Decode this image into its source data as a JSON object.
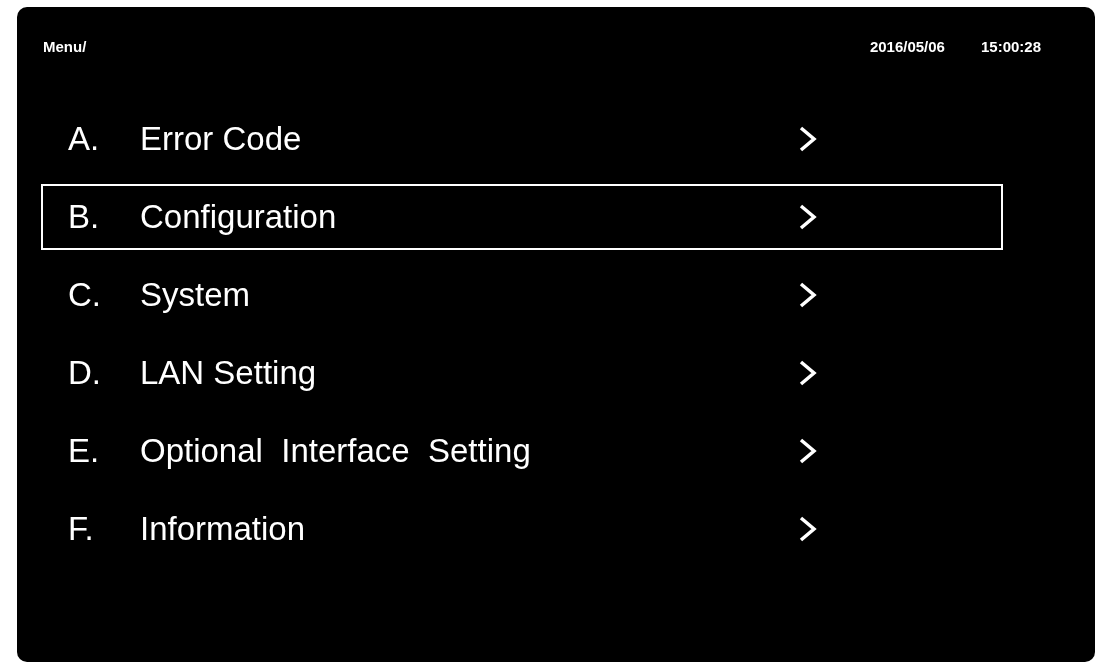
{
  "header": {
    "title": "Menu/",
    "date": "2016/05/06",
    "time": "15:00:28"
  },
  "menu": [
    {
      "letter": "A.",
      "label": "Error Code",
      "selected": false
    },
    {
      "letter": "B.",
      "label": "Configuration",
      "selected": true
    },
    {
      "letter": "C.",
      "label": "System",
      "selected": false
    },
    {
      "letter": "D.",
      "label": "LAN Setting",
      "selected": false
    },
    {
      "letter": "E.",
      "label": "Optional  Interface  Setting",
      "selected": false
    },
    {
      "letter": "F.",
      "label": "Information",
      "selected": false
    }
  ]
}
